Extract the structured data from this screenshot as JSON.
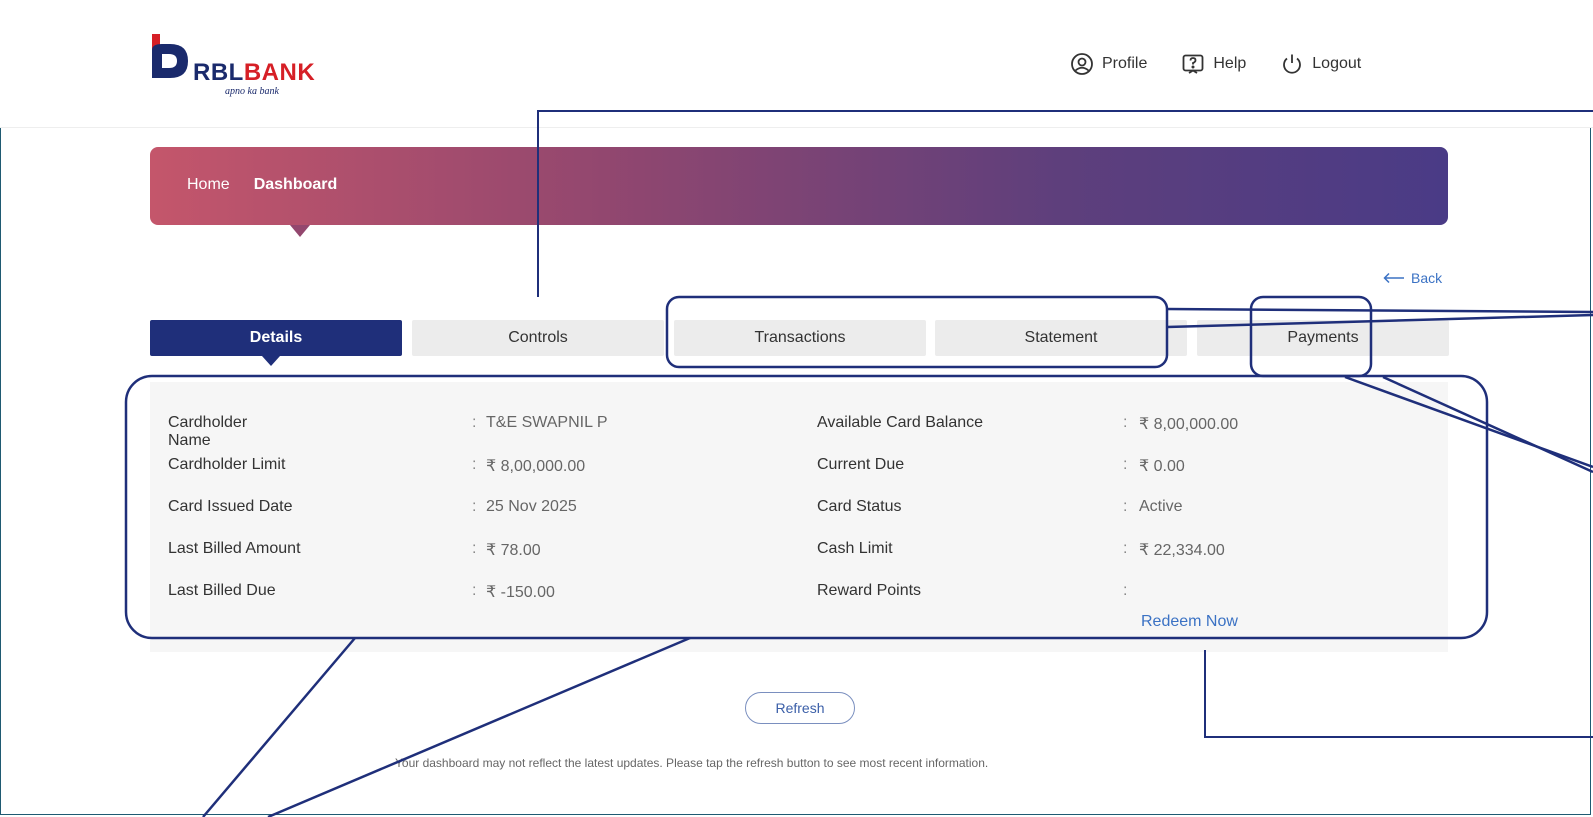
{
  "header": {
    "logo": {
      "brand_rbl": "RBL",
      "brand_bank": "BANK",
      "tagline": "apno ka bank"
    },
    "nav": [
      {
        "label": "Profile",
        "icon": "profile-icon"
      },
      {
        "label": "Help",
        "icon": "help-icon"
      },
      {
        "label": "Logout",
        "icon": "power-icon"
      }
    ]
  },
  "banner": {
    "breadcrumb": [
      "Home",
      "Dashboard"
    ],
    "colors": {
      "start": "#c4566b",
      "end": "#4a3b86"
    }
  },
  "back_label": "Back",
  "tabs": [
    "Details",
    "Controls",
    "Transactions",
    "Statement",
    "Payments"
  ],
  "details": {
    "left": [
      {
        "label": "Cardholder Name",
        "value": "T&E SWAPNIL P"
      },
      {
        "label": "Cardholder Limit",
        "value": "₹ 8,00,000.00"
      },
      {
        "label": "Card Issued Date",
        "value": "25 Nov 2025"
      },
      {
        "label": "Last Billed Amount",
        "value": "₹ 78.00"
      },
      {
        "label": "Last Billed Due",
        "value": "₹ -150.00"
      }
    ],
    "right": [
      {
        "label": "Available Card Balance",
        "value": "₹ 8,00,000.00"
      },
      {
        "label": "Current Due",
        "value": "₹ 0.00"
      },
      {
        "label": "Card Status",
        "value": "Active"
      },
      {
        "label": "Cash Limit",
        "value": "₹ 22,334.00"
      },
      {
        "label": "Reward Points",
        "value": ""
      }
    ],
    "redeem_label": "Redeem Now"
  },
  "refresh_label": "Refresh",
  "note": "Your dashboard may not reflect the latest updates. Please tap the refresh button to see most recent information.",
  "accent_colors": {
    "primary": "#1f2f7a",
    "link": "#3b72c4",
    "annotation": "#1f2f7a"
  }
}
